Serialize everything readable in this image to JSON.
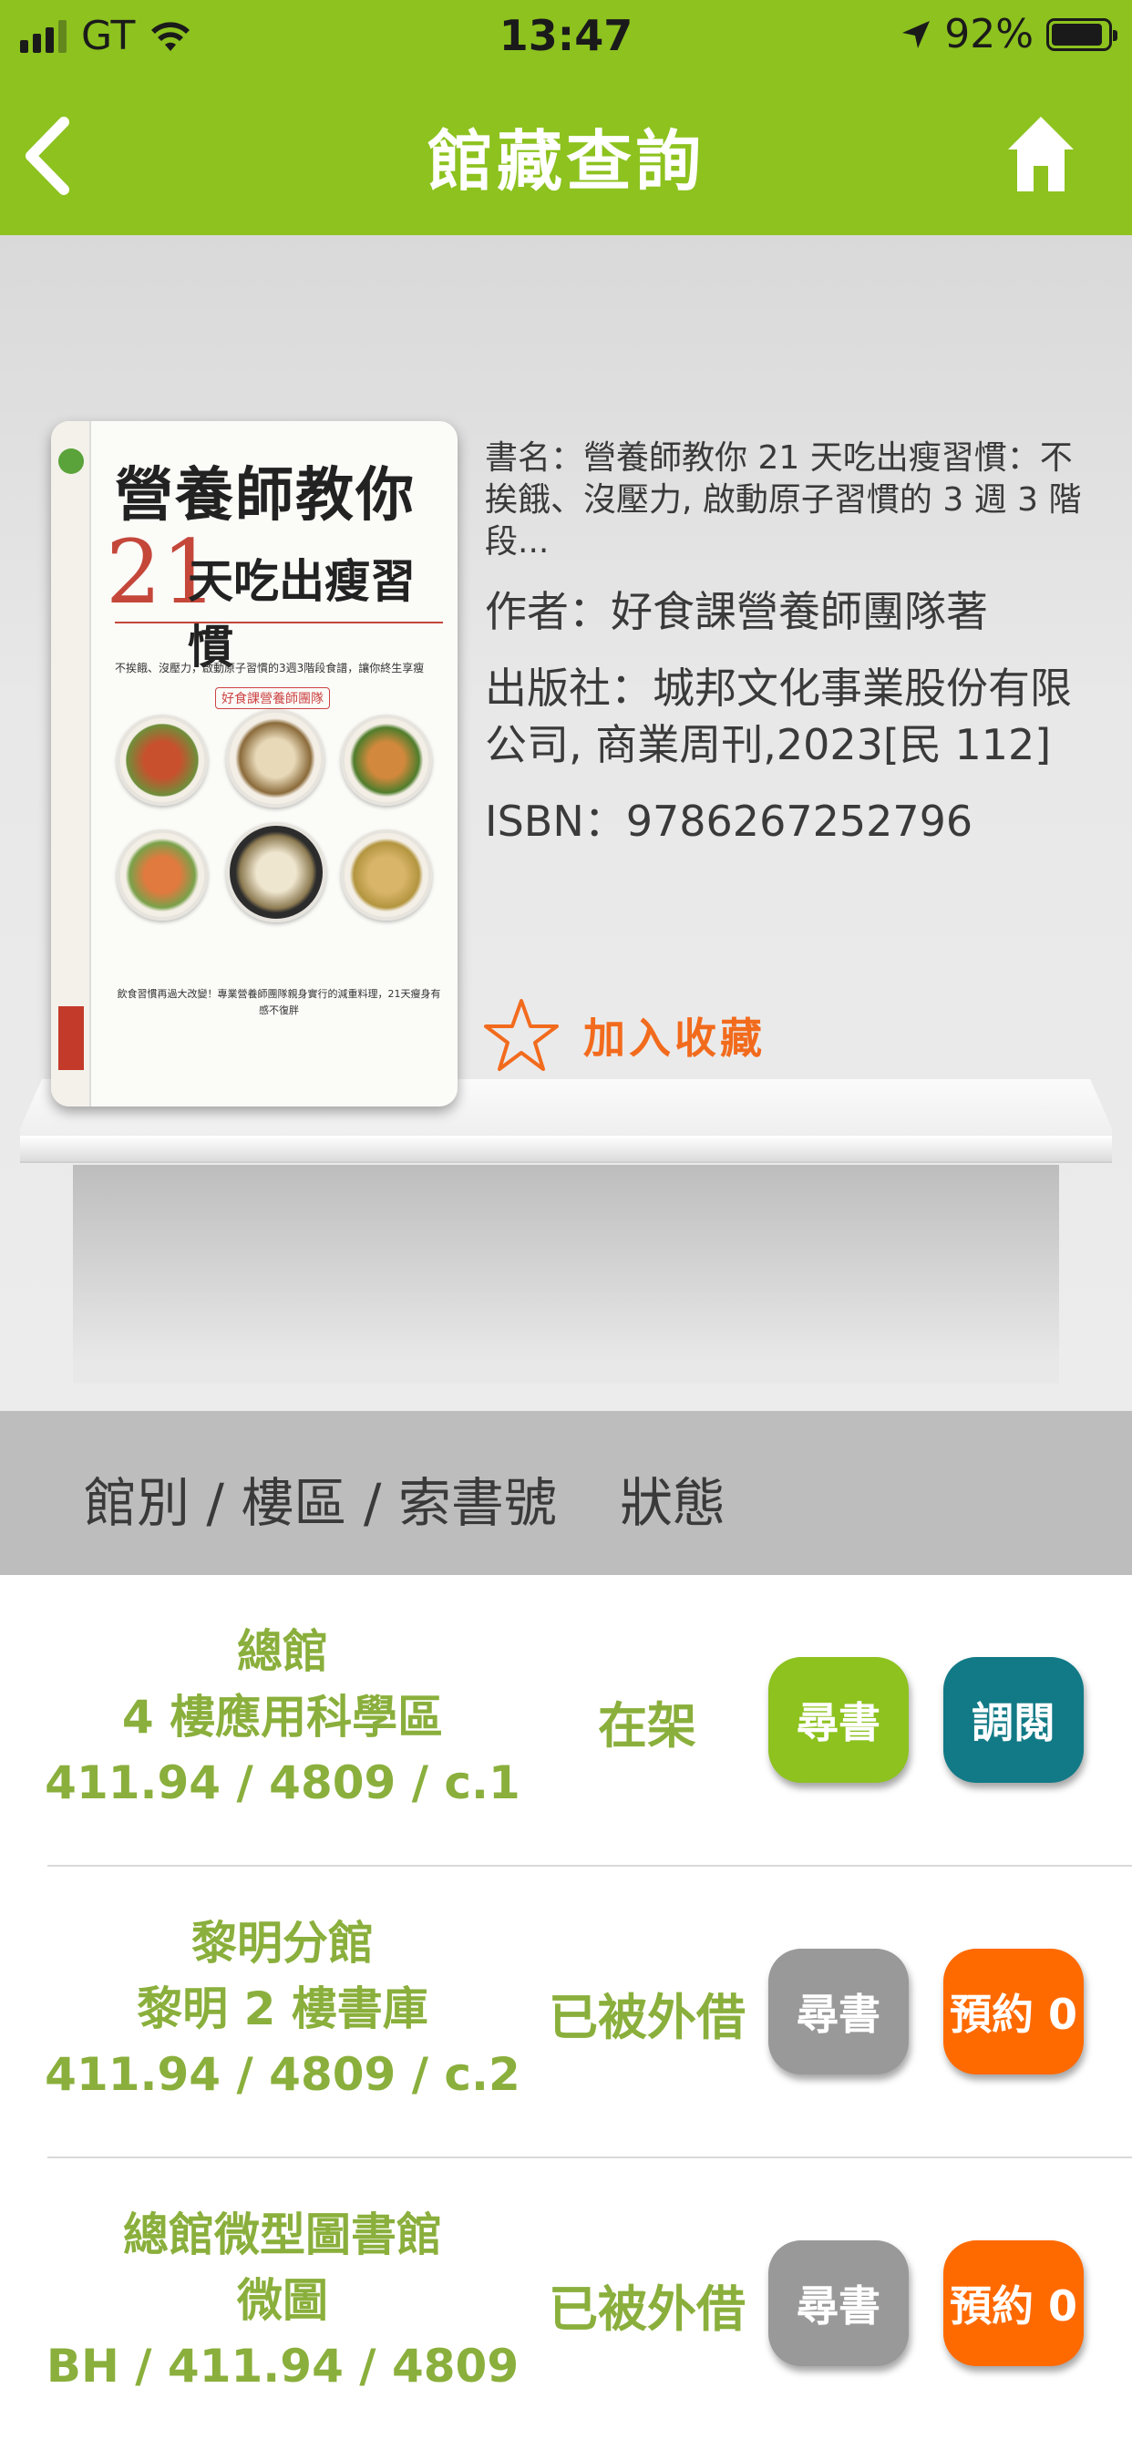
{
  "status_bar": {
    "carrier": "GT",
    "time": "13:47",
    "battery": "92%",
    "battery_level": 0.92
  },
  "nav": {
    "title": "館藏查詢",
    "back_icon": "chevron-left-icon",
    "home_icon": "home-icon"
  },
  "cover": {
    "title_line1": "營養師教你",
    "title_21": "21",
    "title_line2": "天吃出瘦習慣",
    "subtitle": "不挨餓、沒壓力，啟動原子習慣的3週3階段食譜，讓你終生享瘦",
    "tag": "好食課營養師團隊",
    "bottom_text": "飲食習慣再過大改變！專業營養師團隊親身實行的減重料理，21天瘦身有感不復胖"
  },
  "book": {
    "title": "書名：營養師教你 21 天吃出瘦習慣：不挨餓、沒壓力, 啟動原子習慣的 3 週 3 階段...",
    "author": "作者：好食課營養師團隊著",
    "publisher": "出版社：城邦文化事業股份有限公司, 商業周刊,2023[民 112]",
    "isbn": "ISBN：9786267252796",
    "favorite_label": "加入收藏"
  },
  "table": {
    "headers": {
      "location": "館別 / 樓區 / 索書號",
      "status": "狀態"
    },
    "rows": [
      {
        "branch": "總館",
        "area": "4 樓應用科學區",
        "call_number": "411.94 / 4809 / c.1",
        "status": "在架",
        "find_label": "尋書",
        "action_label": "調閱",
        "find_color": "#8dc21f",
        "action_color": "#117a86"
      },
      {
        "branch": "黎明分館",
        "area": "黎明 2 樓書庫",
        "call_number": "411.94 / 4809 / c.2",
        "status": "已被外借",
        "find_label": "尋書",
        "action_label": "預約 0",
        "find_color": "#999999",
        "action_color": "#ff6a00"
      },
      {
        "branch": "總館微型圖書館",
        "area": "微圖",
        "call_number": "BH / 411.94 / 4809",
        "status": "已被外借",
        "find_label": "尋書",
        "action_label": "預約 0",
        "find_color": "#999999",
        "action_color": "#ff6a00"
      }
    ]
  },
  "colors": {
    "brand_green": "#8dc21f",
    "accent_orange": "#f26b1d",
    "text_green": "#8aaf3c"
  }
}
